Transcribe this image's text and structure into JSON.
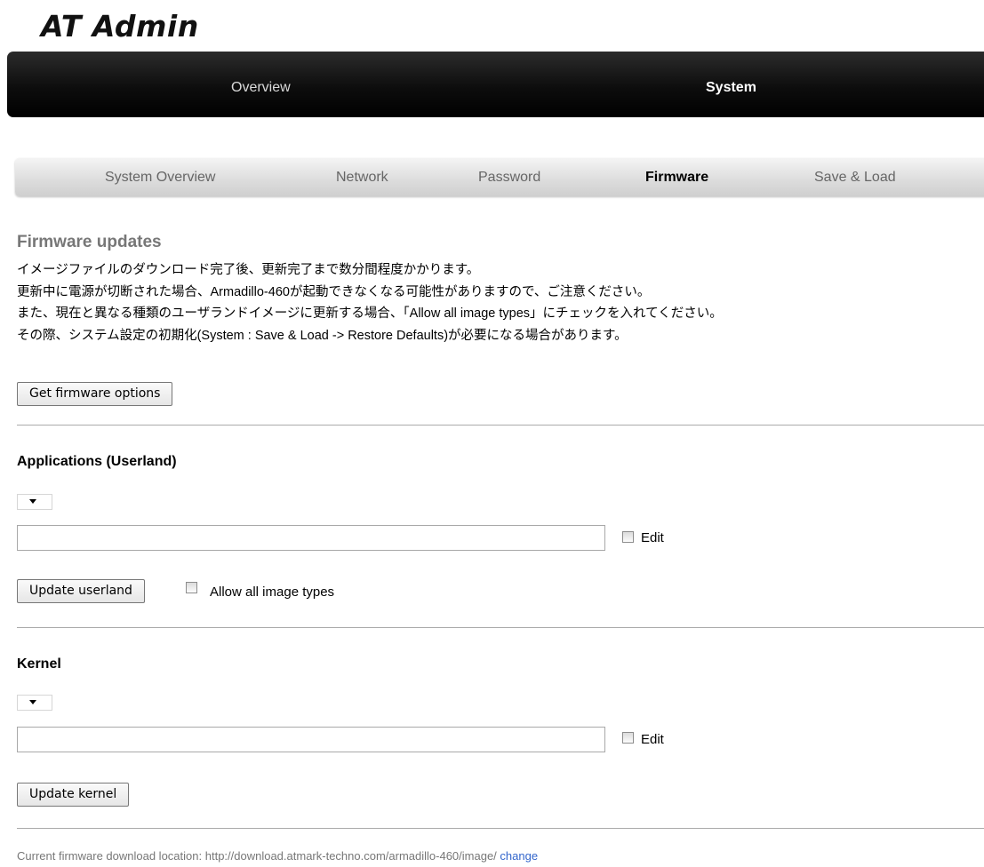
{
  "app_title": "AT Admin",
  "main_nav": {
    "overview": "Overview",
    "system": "System",
    "active": "System"
  },
  "sub_nav": {
    "items": [
      "System Overview",
      "Network",
      "Password",
      "Firmware",
      "Save & Load"
    ],
    "active": "Firmware"
  },
  "firmware": {
    "title": "Firmware updates",
    "description": [
      "イメージファイルのダウンロード完了後、更新完了まで数分間程度かかります。",
      "更新中に電源が切断された場合、Armadillo-460が起動できなくなる可能性がありますので、ご注意ください。",
      "また、現在と異なる種類のユーザランドイメージに更新する場合、「Allow all image types」にチェックを入れてください。",
      "その際、システム設定の初期化(System : Save & Load -> Restore Defaults)が必要になる場合があります。"
    ],
    "get_options_button": "Get firmware options"
  },
  "userland": {
    "title": "Applications (Userland)",
    "select_value": "",
    "input_value": "",
    "edit_label": "Edit",
    "edit_checked": false,
    "update_button": "Update userland",
    "allow_all_label": "Allow all image types",
    "allow_all_checked": false
  },
  "kernel": {
    "title": "Kernel",
    "select_value": "",
    "input_value": "",
    "edit_label": "Edit",
    "edit_checked": false,
    "update_button": "Update kernel"
  },
  "footer": {
    "prefix": "Current firmware download location:",
    "url": "http://download.atmark-techno.com/armadillo-460/image/",
    "change_link": "change"
  }
}
